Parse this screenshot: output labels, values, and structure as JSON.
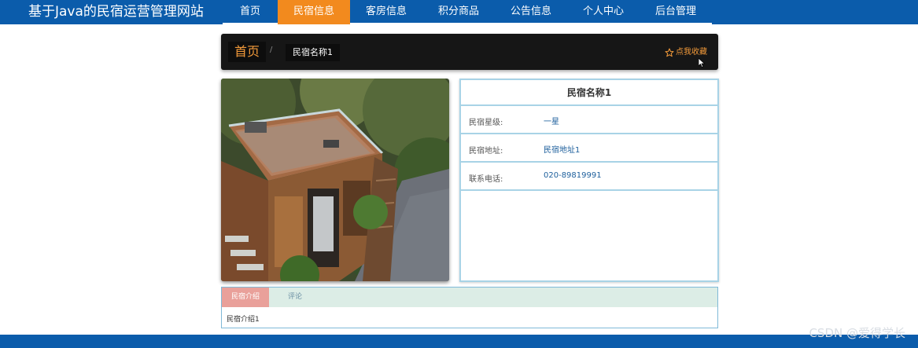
{
  "header": {
    "site_title": "基于Java的民宿运营管理网站",
    "nav": [
      {
        "label": "首页"
      },
      {
        "label": "民宿信息"
      },
      {
        "label": "客房信息"
      },
      {
        "label": "积分商品"
      },
      {
        "label": "公告信息"
      },
      {
        "label": "个人中心"
      },
      {
        "label": "后台管理"
      }
    ],
    "active_index": 1
  },
  "breadcrumb": {
    "home": "首页",
    "separator": "/",
    "current": "民宿名称1",
    "favorite_label": "点我收藏",
    "favorite_icon": "star-outline-icon"
  },
  "detail": {
    "title": "民宿名称1",
    "fields": [
      {
        "label": "民宿星级:",
        "value": "一星"
      },
      {
        "label": "民宿地址:",
        "value": "民宿地址1"
      },
      {
        "label": "联系电话:",
        "value": "020-89819991"
      }
    ]
  },
  "tabs": {
    "items": [
      {
        "label": "民宿介绍"
      },
      {
        "label": "评论"
      }
    ],
    "content": "民宿介绍1"
  },
  "watermark": "CSDN @爱得学长",
  "colors": {
    "nav_bg": "#0b5cab",
    "nav_active": "#f28a1e",
    "accent_orange": "#f29a3a",
    "panel_border": "#a8d3e6"
  }
}
